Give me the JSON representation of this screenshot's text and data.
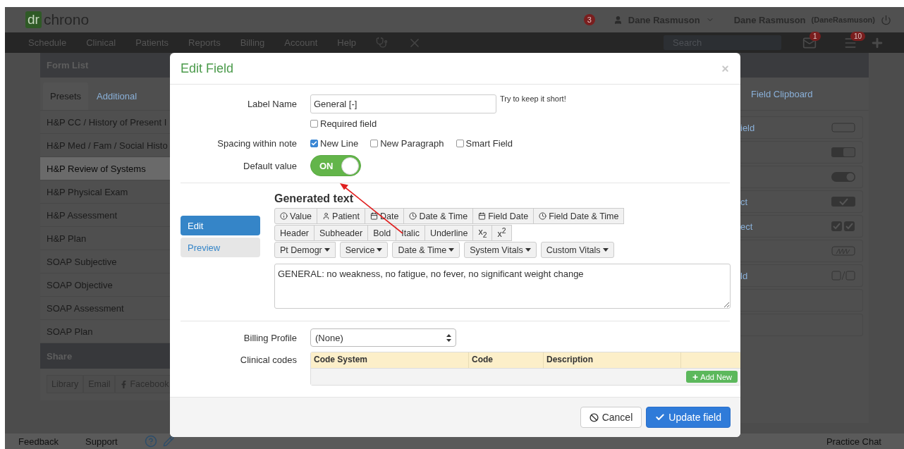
{
  "header": {
    "logo_mark": "dr",
    "logo_text": "chrono",
    "notifications": "3",
    "user_menu": "Dane Rasmuson",
    "account_name": "Dane Rasmuson",
    "account_username": "(DaneRasmuson)"
  },
  "nav": {
    "items": [
      "Schedule",
      "Clinical",
      "Patients",
      "Reports",
      "Billing",
      "Account",
      "Help"
    ],
    "search": {
      "placeholder": "Search"
    },
    "messages_badge": "1",
    "tasks_badge": "10"
  },
  "form_list": {
    "title": "Form List",
    "tabs": [
      {
        "label": "Presets",
        "selected": true
      },
      {
        "label": "Additional",
        "selected": false
      }
    ],
    "items": [
      {
        "label": "H&P CC / History of Present I",
        "selected": false
      },
      {
        "label": "H&P Med / Fam / Social Histo",
        "selected": false
      },
      {
        "label": "H&P Review of Systems",
        "selected": true
      },
      {
        "label": "H&P Physical Exam",
        "selected": false
      },
      {
        "label": "H&P Assessment",
        "selected": false
      },
      {
        "label": "H&P Plan",
        "selected": false
      },
      {
        "label": "SOAP Subjective",
        "selected": false
      },
      {
        "label": "SOAP Objective",
        "selected": false
      },
      {
        "label": "SOAP Assessment",
        "selected": false
      },
      {
        "label": "SOAP Plan",
        "selected": false
      }
    ],
    "share": {
      "title": "Share",
      "buttons": [
        "Library",
        "Email",
        "Facebook"
      ]
    }
  },
  "clipboard": {
    "tab": "Field Clipboard",
    "items": [
      {
        "label": "ield",
        "kind": "text"
      },
      {
        "kind": "yesno"
      },
      {
        "kind": "toggle"
      },
      {
        "label": "ct",
        "kind": "check"
      },
      {
        "label": "ect",
        "kind": "multicheck"
      },
      {
        "kind": "signature"
      },
      {
        "label": "ld",
        "kind": "pair"
      },
      {
        "kind": "empty"
      },
      {
        "kind": "empty"
      }
    ]
  },
  "dialog": {
    "title": "Edit Field",
    "label_name": {
      "label": "Label Name",
      "value": "General [-]",
      "hint": "Try to keep it short!"
    },
    "required": {
      "label": "Required field",
      "checked": false
    },
    "spacing": {
      "label": "Spacing within note",
      "options": [
        {
          "label": "New Line",
          "checked": true
        },
        {
          "label": "New Paragraph",
          "checked": false
        },
        {
          "label": "Smart Field",
          "checked": false
        }
      ]
    },
    "default_value": {
      "label": "Default value",
      "on": true,
      "text": "ON"
    },
    "generated": {
      "title": "Generated text",
      "modes": [
        {
          "label": "Edit",
          "selected": true
        },
        {
          "label": "Preview",
          "selected": false
        }
      ],
      "toolbar": [
        {
          "kind": "insert",
          "buttons": [
            "Value",
            "Patient",
            "Date",
            "Date & Time",
            "Field Date",
            "Field Date & Time"
          ]
        },
        {
          "kind": "format",
          "buttons": [
            "Header",
            "Subheader",
            "Bold",
            "Italic",
            "Underline",
            "x$_{2}$",
            "x$^{2}$"
          ]
        },
        {
          "kind": "menu",
          "buttons": [
            "Pt Demogr",
            "Service",
            "Date & Time",
            "System Vitals",
            "Custom Vitals"
          ]
        }
      ],
      "text": "GENERAL: no weakness, no fatigue, no fever, no significant weight change"
    },
    "billing": {
      "label": "Billing Profile",
      "value": "(None)"
    },
    "codes": {
      "label": "Clinical codes",
      "columns": [
        "Code System",
        "Code",
        "Description"
      ],
      "add_button": "Add New"
    },
    "buttons": [
      {
        "label": "Cancel",
        "kind": "secondary"
      },
      {
        "label": "Update field",
        "kind": "primary"
      }
    ]
  },
  "footer": {
    "links": [
      "Feedback",
      "Support"
    ],
    "chat": "Practice Chat"
  }
}
